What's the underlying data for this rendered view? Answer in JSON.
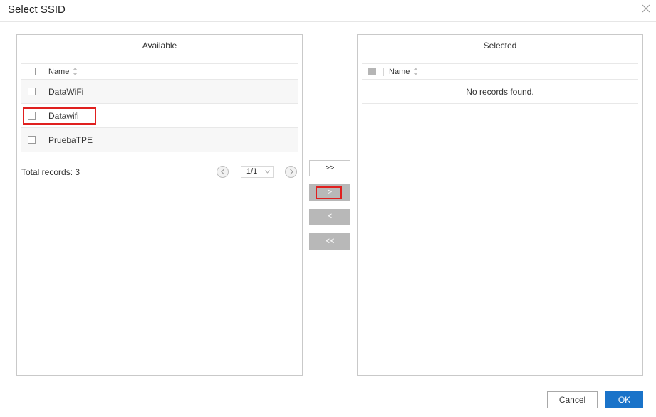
{
  "dialog": {
    "title": "Select SSID"
  },
  "available": {
    "header": "Available",
    "column_name": "Name",
    "rows": [
      {
        "name": "DataWiFi"
      },
      {
        "name": "Datawifi"
      },
      {
        "name": "PruebaTPE"
      }
    ],
    "total_records": "Total records: 3",
    "page": "1/1"
  },
  "selected": {
    "header": "Selected",
    "column_name": "Name",
    "empty_text": "No records found."
  },
  "transfer_buttons": {
    "add_all": ">>",
    "add": ">",
    "remove": "<",
    "remove_all": "<<"
  },
  "actions": {
    "cancel": "Cancel",
    "ok": "OK"
  },
  "colors": {
    "primary": "#1a73c9",
    "highlight": "#e0201f",
    "disabled_button": "#b8b8b8"
  },
  "icons": [
    "close-icon",
    "sort-icon",
    "prev-page-icon",
    "next-page-icon",
    "chevron-down-icon"
  ]
}
